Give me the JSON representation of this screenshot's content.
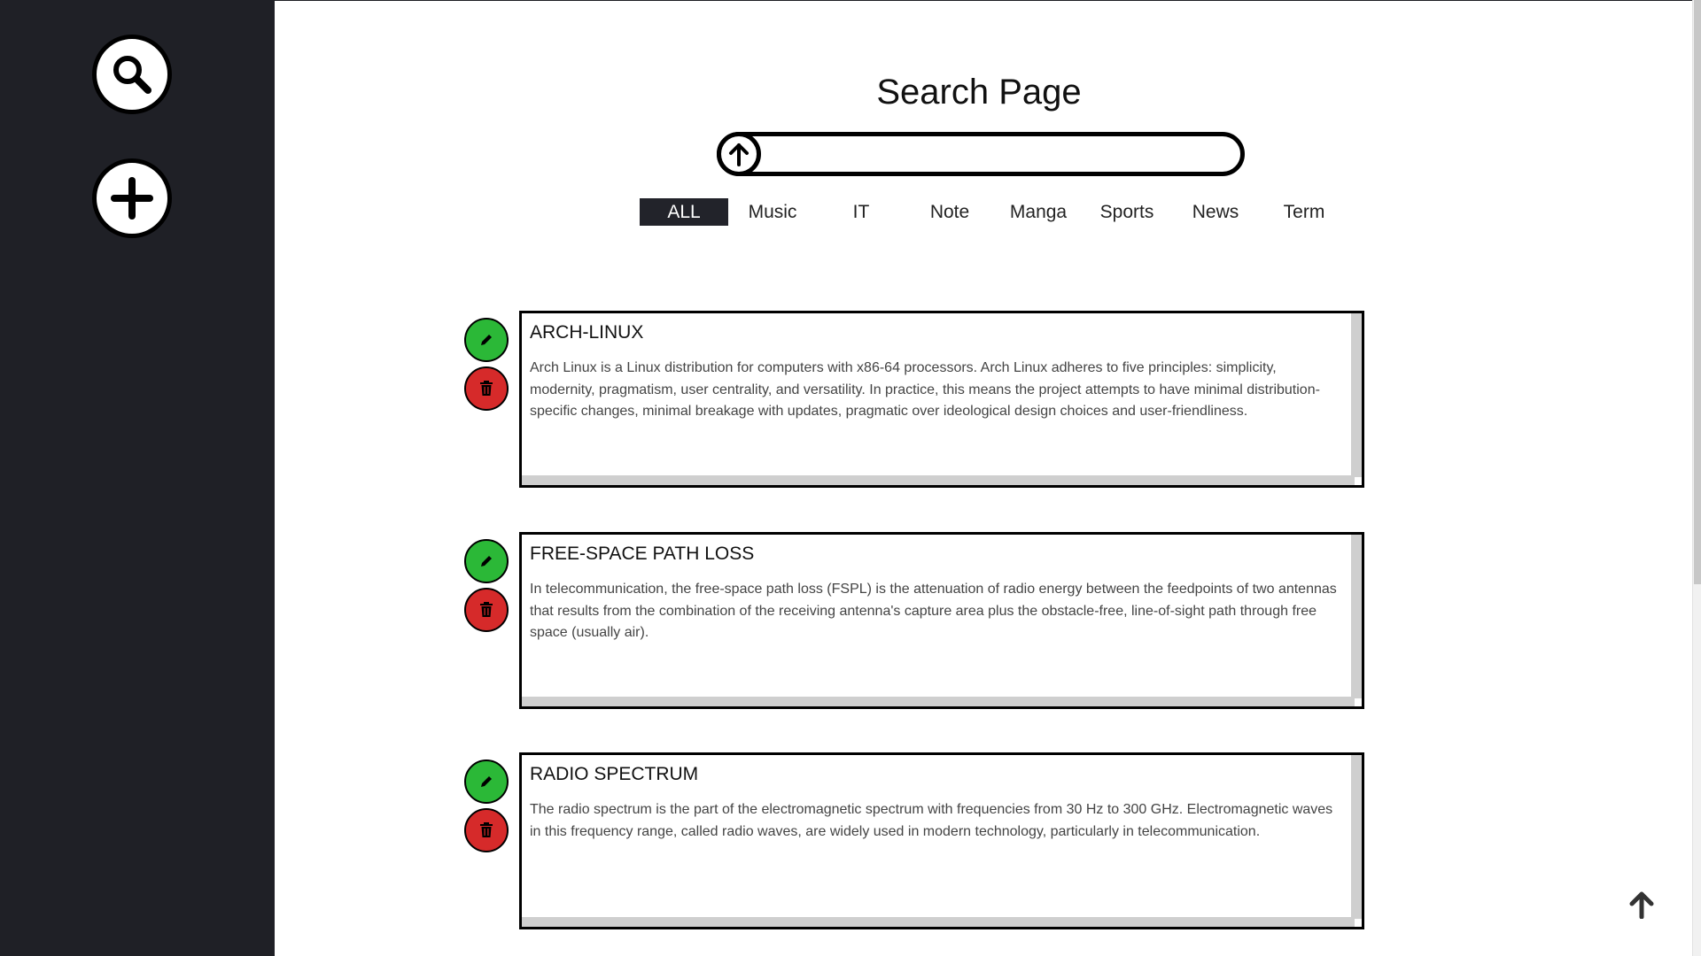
{
  "page": {
    "title": "Search Page"
  },
  "search": {
    "value": "",
    "placeholder": ""
  },
  "tabs": [
    {
      "label": "ALL",
      "active": true
    },
    {
      "label": "Music",
      "active": false
    },
    {
      "label": "IT",
      "active": false
    },
    {
      "label": "Note",
      "active": false
    },
    {
      "label": "Manga",
      "active": false
    },
    {
      "label": "Sports",
      "active": false
    },
    {
      "label": "News",
      "active": false
    },
    {
      "label": "Term",
      "active": false
    }
  ],
  "cards": [
    {
      "title": "ARCH-LINUX",
      "body": "Arch Linux is a Linux distribution for computers with x86-64 processors. Arch Linux adheres to five principles: simplicity, modernity, pragmatism, user centrality, and versatility. In practice, this means the project attempts to have minimal distribution-specific changes, minimal breakage with updates, pragmatic over ideological design choices and user-friendliness."
    },
    {
      "title": "FREE-SPACE PATH LOSS",
      "body": "In telecommunication, the free-space path loss (FSPL) is the attenuation of radio energy between the feedpoints of two antennas that results from the combination of the receiving antenna's capture area plus the obstacle-free, line-of-sight path through free space (usually air)."
    },
    {
      "title": "RADIO SPECTRUM",
      "body": "The radio spectrum is the part of the electromagnetic spectrum with frequencies from 30 Hz to 300 GHz. Electromagnetic waves in this frequency range, called radio waves, are widely used in modern technology, particularly in telecommunication."
    }
  ],
  "icons": {
    "sidebar_search": "search-icon",
    "sidebar_add": "plus-icon",
    "search_submit": "arrow-up-circle-icon",
    "edit": "pencil-icon",
    "delete": "trash-icon",
    "scroll_top": "arrow-up-icon"
  },
  "colors": {
    "sidebar": "#1f2026",
    "active_tab": "#22232a",
    "edit": "#2bb837",
    "delete": "#d62a2a"
  }
}
